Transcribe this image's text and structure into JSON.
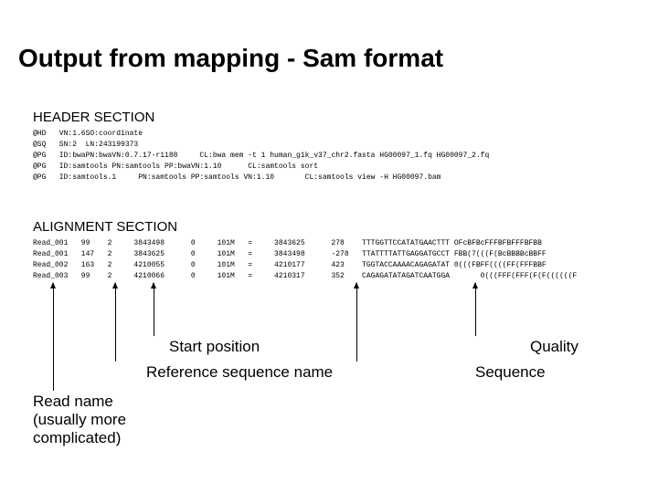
{
  "title": "Output from mapping - Sam format",
  "header_section_label": "HEADER SECTION",
  "header_lines": "@HD   VN:1.6SO:coordinate\n@SQ   SN:2  LN:243199373\n@PG   ID:bwaPN:bwaVN:0.7.17-r1188     CL:bwa mem -t 1 human_g1k_v37_chr2.fasta HG00097_1.fq HG00097_2.fq\n@PG   ID:samtools PN:samtools PP:bwaVN:1.10      CL:samtools sort\n@PG   ID:samtools.1     PN:samtools PP:samtools VN:1.10       CL:samtools view -H HG00097.bam",
  "alignment_section_label": "ALIGNMENT SECTION",
  "alignment_lines": "Read_001   99    2     3843498      0     101M   =     3843625      278    TTTGGTTCCATATGAACTTT OFcBFBcFFFBFBFFFBFBB\nRead_001   147   2     3843625      0     101M   =     3843498      -278   TTATTTTATTGAGGATGCCT FBB(7(((F(BcBBBBcBBFF\nRead_002   163   2     4210055      0     101M   =     4210177      423    TGGTACCAAAACAGAGATAT 0(((FBFF((((FF(FFFBBF\nRead_003   99    2     4210066      0     101M   =     4210317      352    CAGAGATATAGATCAATGGA       0(((FFF(FFF(F(F((((((F",
  "annotations": {
    "start": "Start position",
    "ref": "Reference sequence name",
    "seq": "Sequence",
    "qual": "Quality",
    "read": "Read name\n(usually more\ncomplicated)"
  }
}
